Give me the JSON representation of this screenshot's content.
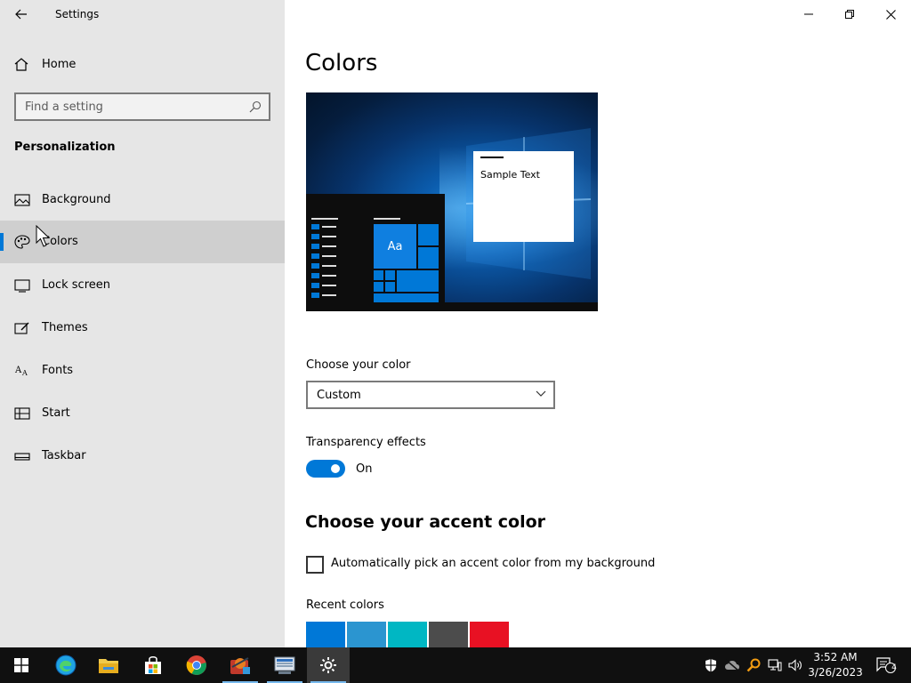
{
  "app": {
    "title": "Settings"
  },
  "sidebar": {
    "home_label": "Home",
    "search_placeholder": "Find a setting",
    "section_heading": "Personalization",
    "items": [
      {
        "label": "Background",
        "icon": "image-icon"
      },
      {
        "label": "Colors",
        "icon": "palette-icon",
        "active": true
      },
      {
        "label": "Lock screen",
        "icon": "lock-screen-icon"
      },
      {
        "label": "Themes",
        "icon": "themes-icon"
      },
      {
        "label": "Fonts",
        "icon": "fonts-icon"
      },
      {
        "label": "Start",
        "icon": "start-icon"
      },
      {
        "label": "Taskbar",
        "icon": "taskbar-icon"
      }
    ]
  },
  "main": {
    "title": "Colors",
    "preview": {
      "sample_text": "Sample Text",
      "tile_text": "Aa"
    },
    "choose_color": {
      "label": "Choose your color",
      "value": "Custom"
    },
    "transparency": {
      "label": "Transparency effects",
      "state": "On"
    },
    "accent": {
      "heading": "Choose your accent color",
      "auto_pick_label": "Automatically pick an accent color from my background",
      "recent_label": "Recent colors",
      "recent_colors": [
        "#0078d7",
        "#2b95d0",
        "#00b7c3",
        "#4c4c4c",
        "#e81123"
      ]
    }
  },
  "taskbar": {
    "apps": [
      "start-icon",
      "edge-icon",
      "file-explorer-icon",
      "store-icon",
      "chrome-icon",
      "app-icon",
      "network-app-icon",
      "settings-icon"
    ],
    "time": "3:52 AM",
    "date": "3/26/2023",
    "notification_count": "4"
  },
  "colors": {
    "accent": "#0078d7",
    "sidebar_bg": "#e6e6e6",
    "taskbar_bg": "#101010"
  }
}
